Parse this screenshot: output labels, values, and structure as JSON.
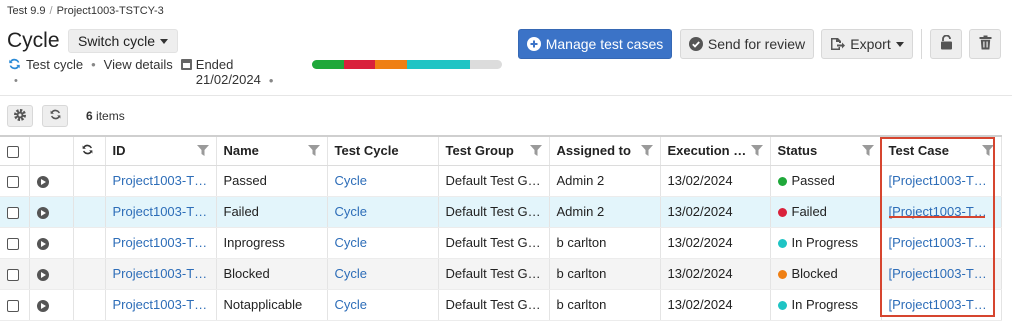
{
  "breadcrumb": {
    "parent": "Test 9.9",
    "current": "Project1003-TSTCY-3"
  },
  "header": {
    "title": "Cycle",
    "switch_label": "Switch cycle",
    "meta": {
      "type": "Test cycle",
      "view_details": "View details",
      "ended_label": "Ended",
      "ended_date": "21/02/2024",
      "bullet": "•"
    }
  },
  "progress": {
    "segments": [
      {
        "color": "#1fa83a",
        "fraction": 0.1667
      },
      {
        "color": "#d9213b",
        "fraction": 0.1667
      },
      {
        "color": "#ef7f13",
        "fraction": 0.1667
      },
      {
        "color": "#1fc4c4",
        "fraction": 0.3333
      }
    ],
    "remaining_color": "#dcdcdc"
  },
  "actions": {
    "manage": "Manage test cases",
    "send_review": "Send for review",
    "export": "Export"
  },
  "toolbar": {
    "count": "6",
    "count_suffix": "items"
  },
  "table": {
    "headers": {
      "id": "ID",
      "name": "Name",
      "cycle": "Test Cycle",
      "group": "Test Group",
      "assigned": "Assigned to",
      "execution": "Execution …",
      "status": "Status",
      "testcase": "Test Case"
    },
    "rows": [
      {
        "id": "Project1003-T…",
        "name": "Passed",
        "cycle": "Cycle",
        "group": "Default Test Gr…",
        "assigned": "Admin 2",
        "date": "13/02/2024",
        "status": "Passed",
        "status_color": "#1fa83a",
        "testcase": "[Project1003-T…"
      },
      {
        "id": "Project1003-T…",
        "name": "Failed",
        "cycle": "Cycle",
        "group": "Default Test Gr…",
        "assigned": "Admin 2",
        "date": "13/02/2024",
        "status": "Failed",
        "status_color": "#d9213b",
        "testcase": "[Project1003-T…"
      },
      {
        "id": "Project1003-T…",
        "name": "Inprogress",
        "cycle": "Cycle",
        "group": "Default Test Gr…",
        "assigned": "b carlton",
        "date": "13/02/2024",
        "status": "In Progress",
        "status_color": "#1fc4c4",
        "testcase": "[Project1003-T…"
      },
      {
        "id": "Project1003-T…",
        "name": "Blocked",
        "cycle": "Cycle",
        "group": "Default Test Gr…",
        "assigned": "b carlton",
        "date": "13/02/2024",
        "status": "Blocked",
        "status_color": "#ef7f13",
        "testcase": "[Project1003-T…"
      },
      {
        "id": "Project1003-T…",
        "name": "Notapplicable",
        "cycle": "Cycle",
        "group": "Default Test Gr…",
        "assigned": "b carlton",
        "date": "13/02/2024",
        "status": "In Progress",
        "status_color": "#1fc4c4",
        "testcase": "[Project1003-T…"
      }
    ]
  },
  "icons": {
    "refresh": "refresh-icon",
    "calendar": "calendar-icon",
    "plus": "plus-circle-icon",
    "check": "check-circle-icon",
    "export": "export-icon",
    "lock": "unlock-icon",
    "trash": "trash-icon",
    "gear": "gear-icon",
    "filter": "filter-icon",
    "play": "play-icon"
  }
}
